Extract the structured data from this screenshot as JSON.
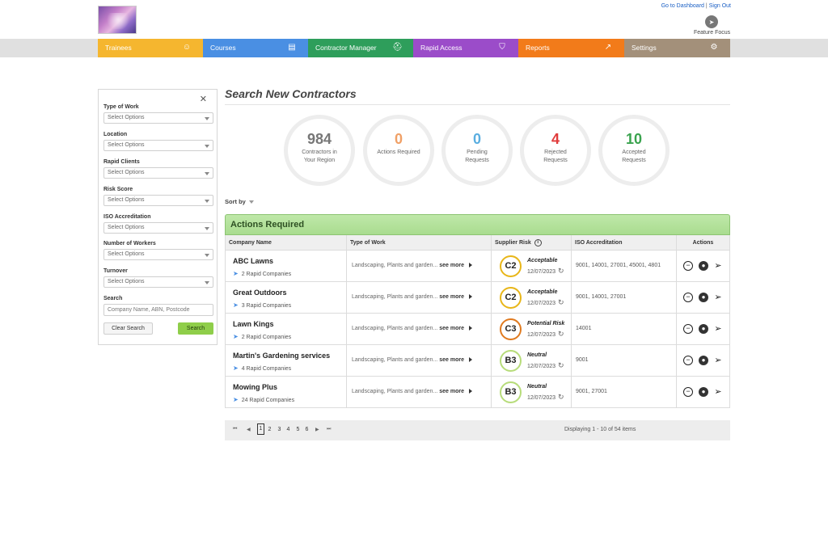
{
  "header": {
    "dashboard_link": "Go to Dashboard",
    "separator": "|",
    "signout_link": "Sign Out",
    "feature_focus_label": "Feature Focus",
    "feature_focus_icon": "paper-plane-icon"
  },
  "nav": [
    {
      "label": "Trainees",
      "icon": "person-icon",
      "color": "#f5b62f"
    },
    {
      "label": "Courses",
      "icon": "document-icon",
      "color": "#4a8fe3"
    },
    {
      "label": "Contractor Manager",
      "icon": "hardhat-icon",
      "color": "#2e9e5b"
    },
    {
      "label": "Rapid Access",
      "icon": "shield-icon",
      "color": "#9b4cc9"
    },
    {
      "label": "Reports",
      "icon": "chart-icon",
      "color": "#f27b1a"
    },
    {
      "label": "Settings",
      "icon": "gear-icon",
      "color": "#a3907a"
    }
  ],
  "filters": {
    "type_of_work": {
      "label": "Type of Work",
      "value": "Select Options"
    },
    "location": {
      "label": "Location",
      "value": "Select Options"
    },
    "rapid_clients": {
      "label": "Rapid Clients",
      "value": "Select Options"
    },
    "risk_score": {
      "label": "Risk Score",
      "value": "Select Options"
    },
    "iso": {
      "label": "ISO Accreditation",
      "value": "Select Options"
    },
    "workers": {
      "label": "Number of Workers",
      "value": "Select Options"
    },
    "turnover": {
      "label": "Turnover",
      "value": "Select Options"
    },
    "search": {
      "label": "Search",
      "placeholder": "Company Name, ABN, Postcode"
    },
    "clear_button": "Clear Search",
    "search_button": "Search"
  },
  "main": {
    "title": "Search New Contractors",
    "sort_by": "Sort by"
  },
  "stats": [
    {
      "value": "984",
      "label": "Contractors in Your Region"
    },
    {
      "value": "0",
      "label": "Actions Required"
    },
    {
      "value": "0",
      "label": "Pending Requests"
    },
    {
      "value": "4",
      "label": "Rejected Requests"
    },
    {
      "value": "10",
      "label": "Accepted Requests"
    }
  ],
  "table": {
    "section_title": "Actions Required",
    "columns": [
      "Company Name",
      "Type of Work",
      "Supplier Risk",
      "ISO Accreditation",
      "Actions"
    ],
    "see_more": "see more",
    "rows": [
      {
        "company": "ABC Lawns",
        "rapid": "2 Rapid Companies",
        "work": "Landscaping, Plants and garden...",
        "risk": "C2",
        "risk_color": "#e8b619",
        "risk_text": "Acceptable",
        "date": "12/07/2023",
        "iso": "9001, 14001, 27001, 45001, 4801"
      },
      {
        "company": "Great Outdoors",
        "rapid": "3 Rapid Companies",
        "work": "Landscaping, Plants and garden...",
        "risk": "C2",
        "risk_color": "#e8b619",
        "risk_text": "Acceptable",
        "date": "12/07/2023",
        "iso": "9001, 14001, 27001"
      },
      {
        "company": "Lawn Kings",
        "rapid": "2 Rapid Companies",
        "work": "Landscaping, Plants and garden...",
        "risk": "C3",
        "risk_color": "#e07a1f",
        "risk_text": "Potential Risk",
        "date": "12/07/2023",
        "iso": "14001"
      },
      {
        "company": "Martin's Gardening services",
        "rapid": "4 Rapid Companies",
        "work": "Landscaping, Plants and garden...",
        "risk": "B3",
        "risk_color": "#b7dc7a",
        "risk_text": "Neutral",
        "date": "12/07/2023",
        "iso": "9001"
      },
      {
        "company": "Mowing Plus",
        "rapid": "24 Rapid Companies",
        "work": "Landscaping, Plants and garden...",
        "risk": "B3",
        "risk_color": "#b7dc7a",
        "risk_text": "Neutral",
        "date": "12/07/2023",
        "iso": "9001, 27001"
      }
    ]
  },
  "pager": {
    "pages": [
      "1",
      "2",
      "3",
      "4",
      "5",
      "6"
    ],
    "current_page": "1",
    "info": "Displaying 1 - 10 of 54 items"
  }
}
